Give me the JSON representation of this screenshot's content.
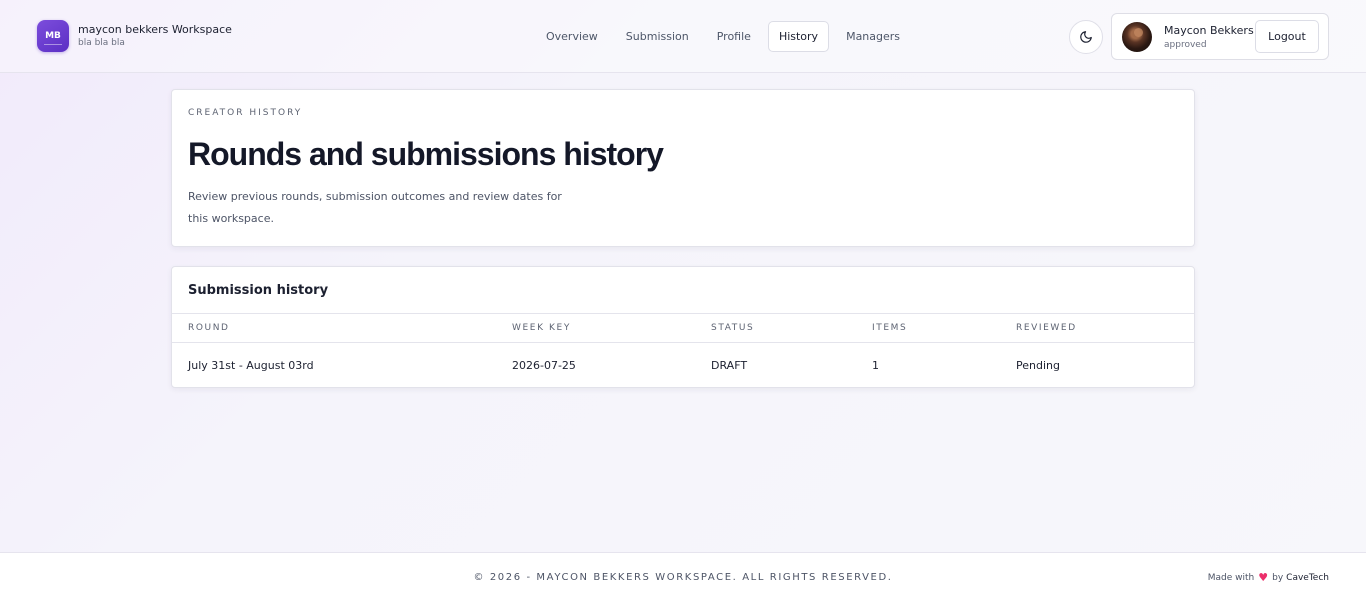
{
  "brand": {
    "initials": "MB",
    "title": "maycon bekkers Workspace",
    "subtitle": "bla bla bla",
    "accent": "#6a3bd4"
  },
  "nav": {
    "items": [
      {
        "label": "Overview"
      },
      {
        "label": "Submission"
      },
      {
        "label": "Profile"
      },
      {
        "label": "History"
      },
      {
        "label": "Managers"
      }
    ],
    "active": "History"
  },
  "theme_toggle": {
    "icon": "moon-icon"
  },
  "user": {
    "name": "Maycon Bekkers",
    "status": "approved",
    "logout_label": "Logout"
  },
  "hero": {
    "eyebrow": "CREATOR HISTORY",
    "title": "Rounds and submissions history",
    "description": "Review previous rounds, submission outcomes and review dates for this workspace."
  },
  "history": {
    "title": "Submission history",
    "columns": [
      "ROUND",
      "WEEK KEY",
      "STATUS",
      "ITEMS",
      "REVIEWED"
    ],
    "rows": [
      {
        "round": "July 31st - August 03rd",
        "week_key": "2026-07-25",
        "status": "DRAFT",
        "items": "1",
        "reviewed": "Pending"
      }
    ]
  },
  "footer": {
    "copyright": "© 2026 - MAYCON BEKKERS WORKSPACE. ALL RIGHTS RESERVED.",
    "made_with": "Made with",
    "by": "by",
    "company": "CaveTech",
    "heart_color": "#ec2f6b"
  }
}
